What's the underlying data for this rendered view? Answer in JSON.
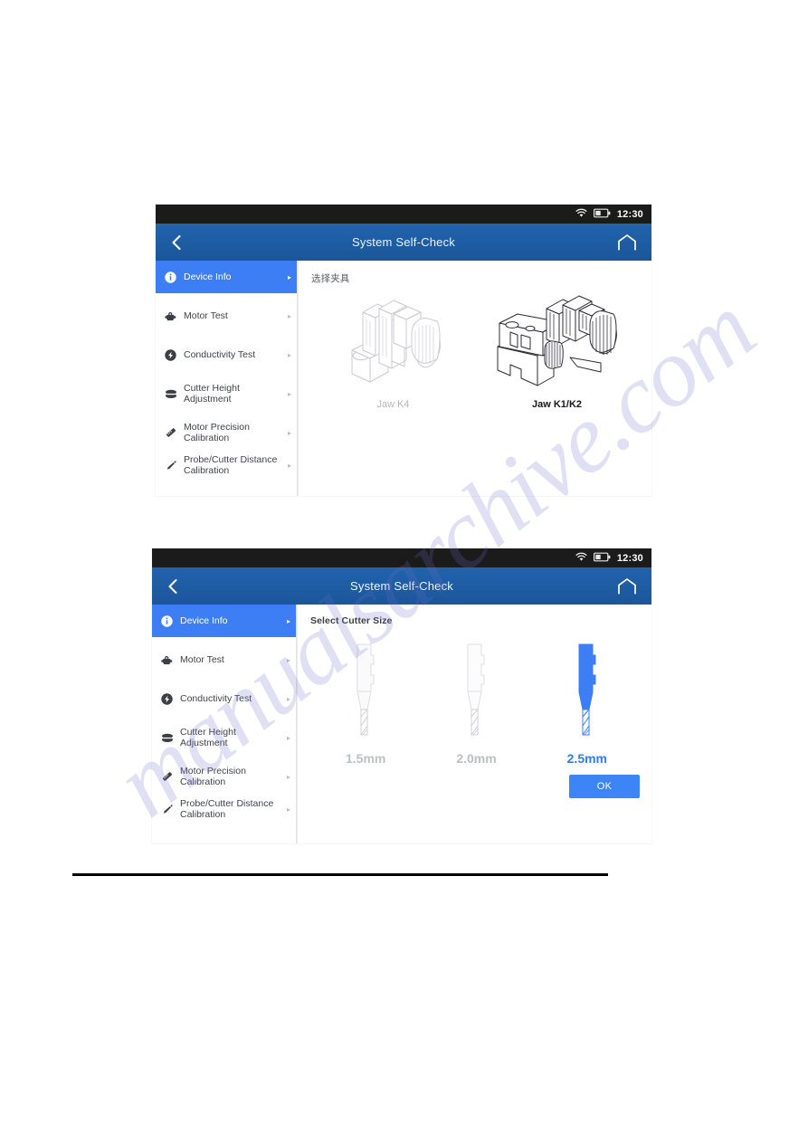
{
  "statusbar": {
    "time": "12:30",
    "wifi_icon": "wifi-icon",
    "battery_icon": "battery-icon"
  },
  "header": {
    "title": "System Self-Check",
    "back_icon": "chevron-left-icon",
    "home_icon": "home-icon",
    "background_color": "#1f5fa8"
  },
  "sidebar": {
    "items": [
      {
        "label": "Device Info",
        "icon": "info-circle-icon",
        "chevron": "▸",
        "active": true
      },
      {
        "label": "Motor Test",
        "icon": "motor-icon",
        "chevron": "▸",
        "active": false
      },
      {
        "label": "Conductivity Test",
        "icon": "bolt-circle-icon",
        "chevron": "▸",
        "active": false
      },
      {
        "label": "Cutter Height Adjustment",
        "icon": "disc-icon",
        "chevron": "▸",
        "active": false
      },
      {
        "label": "Motor Precision\nCalibration",
        "icon": "ruler-icon",
        "chevron": "▸",
        "active": false
      },
      {
        "label": "Probe/Cutter Distance\nCalibration",
        "icon": "probe-pen-icon",
        "chevron": "▸",
        "active": false
      }
    ]
  },
  "panel_one": {
    "content_title": "选择夹具",
    "jaws": [
      {
        "label": "Jaw K4",
        "selected": false
      },
      {
        "label": "Jaw K1/K2",
        "selected": true
      }
    ]
  },
  "panel_two": {
    "content_title": "Select Cutter Size",
    "cutters": [
      {
        "label": "1.5mm",
        "selected": false
      },
      {
        "label": "2.0mm",
        "selected": false
      },
      {
        "label": "2.5mm",
        "selected": true
      }
    ],
    "ok_label": "OK",
    "accent_color": "#3d85f7"
  },
  "watermark": {
    "text": "manualsarchive.com"
  }
}
